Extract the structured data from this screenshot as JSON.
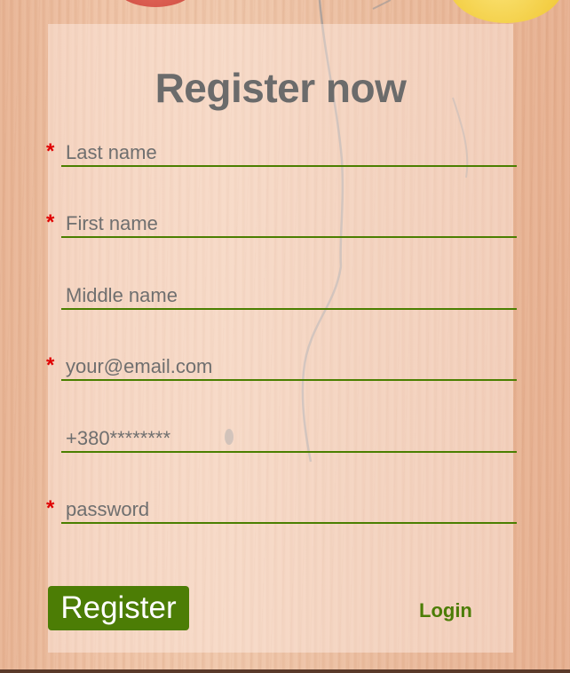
{
  "form": {
    "title": "Register now",
    "required_marker": "*",
    "fields": [
      {
        "placeholder": "Last name",
        "value": "",
        "required": true
      },
      {
        "placeholder": "First name",
        "value": "",
        "required": true
      },
      {
        "placeholder": "Middle name",
        "value": "",
        "required": false
      },
      {
        "placeholder": "your@email.com",
        "value": "",
        "required": true
      },
      {
        "placeholder": "+380********",
        "value": "",
        "required": false
      },
      {
        "placeholder": "password",
        "value": "",
        "required": true
      }
    ],
    "register_label": "Register",
    "login_label": "Login"
  },
  "colors": {
    "accent": "#4c7d05",
    "required_marker": "#e00000",
    "title": "#6b6b6b"
  }
}
